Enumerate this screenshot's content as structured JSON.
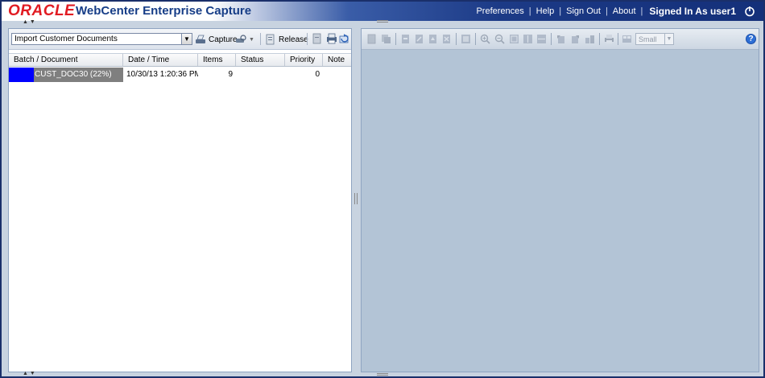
{
  "header": {
    "logo": "ORACLE",
    "title": "WebCenter Enterprise Capture",
    "links": [
      "Preferences",
      "Help",
      "Sign Out",
      "About"
    ],
    "signed_in": "Signed In As user1",
    "logout_icon": "power-icon"
  },
  "left_toolbar": {
    "client_select": "Import Customer Documents",
    "capture_label": "Capture",
    "release_label": "Release"
  },
  "batch_table": {
    "columns": [
      "Batch / Document",
      "Date / Time",
      "Items",
      "Status",
      "Priority",
      "Note"
    ],
    "rows": [
      {
        "batch": "CUST_DOC30 (22%)",
        "progress": 0.22,
        "datetime": "10/30/13 1:20:36 PM",
        "items": "9",
        "status": "",
        "priority": "0",
        "note": ""
      }
    ]
  },
  "right_toolbar": {
    "size_select": "Small",
    "help_icon": "help-icon"
  },
  "colors": {
    "header_dark": "#14307a",
    "oracle_red": "#e11b22",
    "title_blue": "#163d87",
    "progress_blue": "#0000ff",
    "progress_bg": "#7f7f7f",
    "viewer_bg": "#b3c4d6"
  }
}
